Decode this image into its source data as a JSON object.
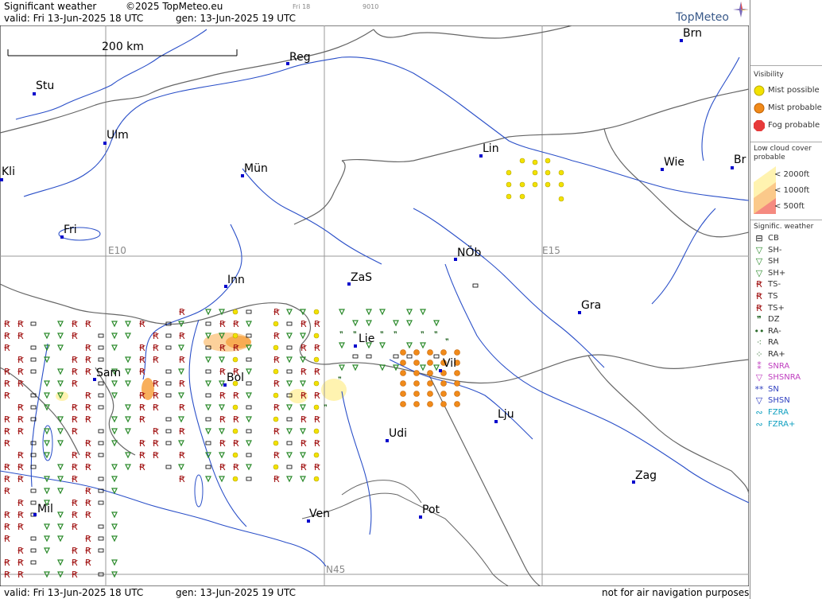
{
  "header": {
    "title": "Significant weather",
    "copyright": "©2025 TopMeteo.eu",
    "valid_line": "valid:  Fri  13-Jun-2025  18 UTC",
    "gen_line": "gen: 13-Jun-2025 19 UTC",
    "small_day": "Fri 18",
    "small_code": "9010",
    "logo": "TopMeteo"
  },
  "footer": {
    "valid_line": "valid:  Fri  13-Jun-2025  18 UTC",
    "gen_line": "gen: 13-Jun-2025 19 UTC",
    "disclaimer": "not for air navigation purposes"
  },
  "map": {
    "scale_label": "200 km",
    "grid_labels": {
      "e10": "E10",
      "e15": "E15",
      "n45": "N45"
    },
    "cities": [
      {
        "name": "Stu"
      },
      {
        "name": "Ulm"
      },
      {
        "name": "Reg"
      },
      {
        "name": "Brn"
      },
      {
        "name": "Kli"
      },
      {
        "name": "Mün"
      },
      {
        "name": "Lin"
      },
      {
        "name": "Wie"
      },
      {
        "name": "Br"
      },
      {
        "name": "Fri"
      },
      {
        "name": "NÖb"
      },
      {
        "name": "Inn"
      },
      {
        "name": "ZaS"
      },
      {
        "name": "Gra"
      },
      {
        "name": "Lie"
      },
      {
        "name": "Sam"
      },
      {
        "name": "Bol"
      },
      {
        "name": "Vil"
      },
      {
        "name": "Lju"
      },
      {
        "name": "Udi"
      },
      {
        "name": "Zag"
      },
      {
        "name": "Mil"
      },
      {
        "name": "Ven"
      },
      {
        "name": "Pot"
      }
    ]
  },
  "legend": {
    "visibility": {
      "title": "Visibility",
      "items": [
        {
          "label": "Mist possible",
          "color": "#f2e200"
        },
        {
          "label": "Mist probable",
          "color": "#f08a1a"
        },
        {
          "label": "Fog probable",
          "color": "#e63a3a"
        }
      ]
    },
    "lowcloud": {
      "title_1": "Low cloud cover",
      "title_2": "probable",
      "items": [
        {
          "label": "< 2000ft",
          "color": "#fff3b0"
        },
        {
          "label": "< 1000ft",
          "color": "#fbc98a"
        },
        {
          "label": "<   500ft",
          "color": "#f58a80"
        }
      ]
    },
    "weather": {
      "title": "Signific. weather",
      "items": [
        {
          "label": "CB",
          "icon": "cb-icon",
          "color": "#000000"
        },
        {
          "label": "SH-",
          "icon": "shower-light-icon",
          "color": "#2a8a2a"
        },
        {
          "label": "SH",
          "icon": "shower-icon",
          "color": "#2a8a2a"
        },
        {
          "label": "SH+",
          "icon": "shower-heavy-icon",
          "color": "#2a8a2a"
        },
        {
          "label": "TS-",
          "icon": "thunderstorm-light-icon",
          "color": "#a01010"
        },
        {
          "label": "TS",
          "icon": "thunderstorm-icon",
          "color": "#a01010"
        },
        {
          "label": "TS+",
          "icon": "thunderstorm-heavy-icon",
          "color": "#a01010"
        },
        {
          "label": "DZ",
          "icon": "drizzle-icon",
          "color": "#2a6a2a"
        },
        {
          "label": "RA-",
          "icon": "rain-light-icon",
          "color": "#2a6a2a"
        },
        {
          "label": "RA",
          "icon": "rain-icon",
          "color": "#2a6a2a"
        },
        {
          "label": "RA+",
          "icon": "rain-heavy-icon",
          "color": "#2a6a2a"
        },
        {
          "label": "SNRA",
          "icon": "snow-rain-icon",
          "color": "#c040c0"
        },
        {
          "label": "SHSNRA",
          "icon": "snow-rain-shower-icon",
          "color": "#c040c0"
        },
        {
          "label": "SN",
          "icon": "snow-icon",
          "color": "#3040c0"
        },
        {
          "label": "SHSN",
          "icon": "snow-shower-icon",
          "color": "#3040c0"
        },
        {
          "label": "FZRA",
          "icon": "freezing-rain-icon",
          "color": "#10a0c0"
        },
        {
          "label": "FZRA+",
          "icon": "freezing-rain-heavy-icon",
          "color": "#10a0c0"
        }
      ]
    }
  }
}
